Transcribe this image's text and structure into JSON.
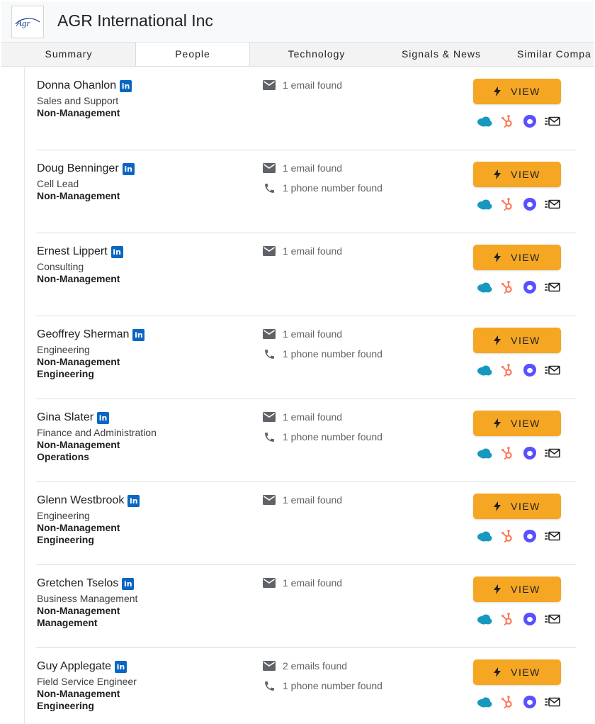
{
  "company": {
    "name": "AGR International Inc",
    "logo_text": "AGR"
  },
  "tabs": [
    {
      "label": "Summary",
      "active": false
    },
    {
      "label": "People",
      "active": true
    },
    {
      "label": "Technology",
      "active": false
    },
    {
      "label": "Signals & News",
      "active": false
    },
    {
      "label": "Similar Compa",
      "active": false
    }
  ],
  "view_button_label": "VIEW",
  "icons": {
    "email": "email-icon",
    "phone": "phone-icon",
    "linkedin": "linkedin-icon",
    "bolt": "bolt-icon",
    "integrations": [
      "salesforce-icon",
      "hubspot-icon",
      "outreach-icon",
      "salesloft-icon"
    ]
  },
  "colors": {
    "accent": "#f5a623",
    "linkedin": "#0a66c2",
    "salesforce": "#1798c1",
    "hubspot": "#ff7a59",
    "outreach": "#5951ff"
  },
  "people": [
    {
      "name": "Donna Ohanlon",
      "department": "Sales and Support",
      "level": "Non-Management",
      "function": "",
      "email": "1 email found",
      "phone": ""
    },
    {
      "name": "Doug Benninger",
      "department": "Cell Lead",
      "level": "Non-Management",
      "function": "",
      "email": "1 email found",
      "phone": "1 phone number found"
    },
    {
      "name": "Ernest Lippert",
      "department": "Consulting",
      "level": "Non-Management",
      "function": "",
      "email": "1 email found",
      "phone": ""
    },
    {
      "name": "Geoffrey Sherman",
      "department": "Engineering",
      "level": "Non-Management",
      "function": "Engineering",
      "email": "1 email found",
      "phone": "1 phone number found"
    },
    {
      "name": "Gina Slater",
      "department": "Finance and Administration",
      "level": "Non-Management",
      "function": "Operations",
      "email": "1 email found",
      "phone": "1 phone number found"
    },
    {
      "name": "Glenn Westbrook",
      "department": "Engineering",
      "level": "Non-Management",
      "function": "Engineering",
      "email": "1 email found",
      "phone": ""
    },
    {
      "name": "Gretchen Tselos",
      "department": "Business Management",
      "level": "Non-Management",
      "function": "Management",
      "email": "1 email found",
      "phone": ""
    },
    {
      "name": "Guy Applegate",
      "department": "Field Service Engineer",
      "level": "Non-Management",
      "function": "Engineering",
      "email": "2 emails found",
      "phone": "1 phone number found"
    }
  ]
}
